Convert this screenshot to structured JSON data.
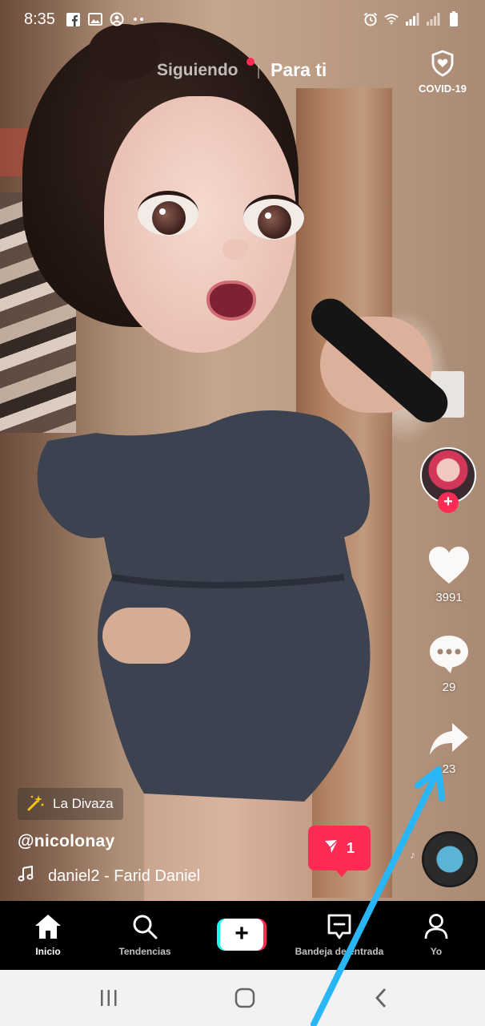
{
  "status_bar": {
    "time": "8:35",
    "left_icons": [
      "facebook-icon",
      "image-icon",
      "instagram-icon",
      "more-dots-icon"
    ],
    "right_icons": [
      "alarm-icon",
      "wifi-icon",
      "signal-icon",
      "signal-icon",
      "battery-icon"
    ]
  },
  "top_tabs": {
    "following": "Siguiendo",
    "for_you": "Para ti",
    "active": "for_you"
  },
  "covid": {
    "label": "COVID-19",
    "icon": "shield-heart-icon"
  },
  "actions": {
    "likes": "3991",
    "comments": "29",
    "shares": "23"
  },
  "video": {
    "effect": "La Divaza",
    "username": "@nicolonay",
    "music": "daniel2 - Farid Daniel"
  },
  "inbox_badge": {
    "count": "1"
  },
  "bottom_nav": {
    "home": "Inicio",
    "discover": "Tendencias",
    "inbox": "Bandeja de entrada",
    "profile": "Yo"
  },
  "colors": {
    "accent_red": "#fe2c55",
    "accent_cyan": "#25f4ee",
    "annotation_arrow": "#29b6f6"
  }
}
